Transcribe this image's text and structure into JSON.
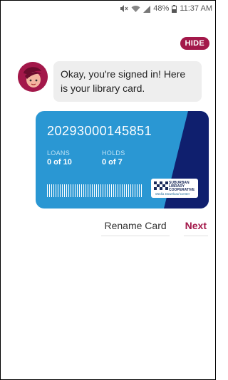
{
  "status_bar": {
    "battery": "48%",
    "time": "11:37 AM",
    "icons": [
      "mute-icon",
      "wifi-icon",
      "signal-icon",
      "battery-icon"
    ]
  },
  "header": {
    "hide_label": "HIDE"
  },
  "chat": {
    "message": "Okay, you're signed in! Here is your library card."
  },
  "card": {
    "number": "20293000145851",
    "loans_label": "LOANS",
    "loans_value": "0 of 10",
    "holds_label": "HOLDS",
    "holds_value": "0 of 7",
    "logo_lines": [
      "SUBURBAN",
      "LIBRARY",
      "COOPERATIVE"
    ],
    "logo_tagline": "Media Download Center"
  },
  "actions": {
    "rename_label": "Rename Card",
    "next_label": "Next"
  },
  "colors": {
    "accent": "#a3184a",
    "card_blue": "#2a97d3",
    "card_navy": "#0f1f6e"
  }
}
